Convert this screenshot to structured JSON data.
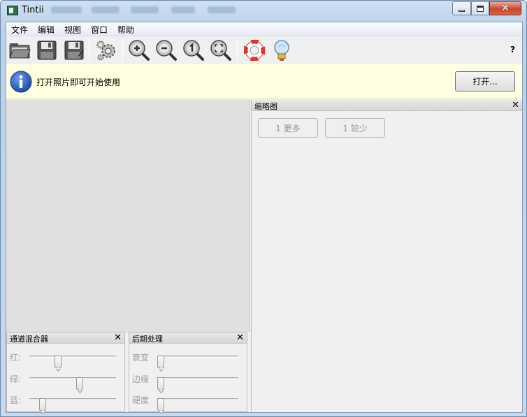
{
  "window": {
    "title": "Tintii",
    "close_glyph": "✕"
  },
  "menu": {
    "items": [
      "文件",
      "编辑",
      "视图",
      "窗口",
      "帮助"
    ]
  },
  "toolbar": {
    "buttons": [
      "open-folder-icon",
      "save-icon",
      "save-as-icon",
      "settings-gear-icon",
      "zoom-in-icon",
      "zoom-out-icon",
      "zoom-actual-icon",
      "zoom-fit-icon",
      "help-lifebuoy-icon",
      "tip-lightbulb-icon"
    ],
    "help_label": "?"
  },
  "infobar": {
    "message": "打开照片即可开始使用",
    "open_button": "打开..."
  },
  "thumbnails": {
    "title": "缩略图",
    "more_button": "1 更多",
    "fewer_button": "1 较少",
    "close_glyph": "✕"
  },
  "channel_mixer": {
    "title": "通道混合器",
    "close_glyph": "✕",
    "sliders": [
      {
        "label": "红:",
        "value": 0.33
      },
      {
        "label": "绿:",
        "value": 0.58
      },
      {
        "label": "蓝:",
        "value": 0.15
      }
    ]
  },
  "post_processing": {
    "title": "后期处理",
    "close_glyph": "✕",
    "sliders": [
      {
        "label": "衰变",
        "value": 0.0
      },
      {
        "label": "边缘",
        "value": 0.0
      },
      {
        "label": "硬度",
        "value": 0.0
      }
    ]
  },
  "colors": {
    "infobar_background": "#ffffe1",
    "canvas_background": "#e0e0e0",
    "close_button_red": "#c8452c"
  }
}
